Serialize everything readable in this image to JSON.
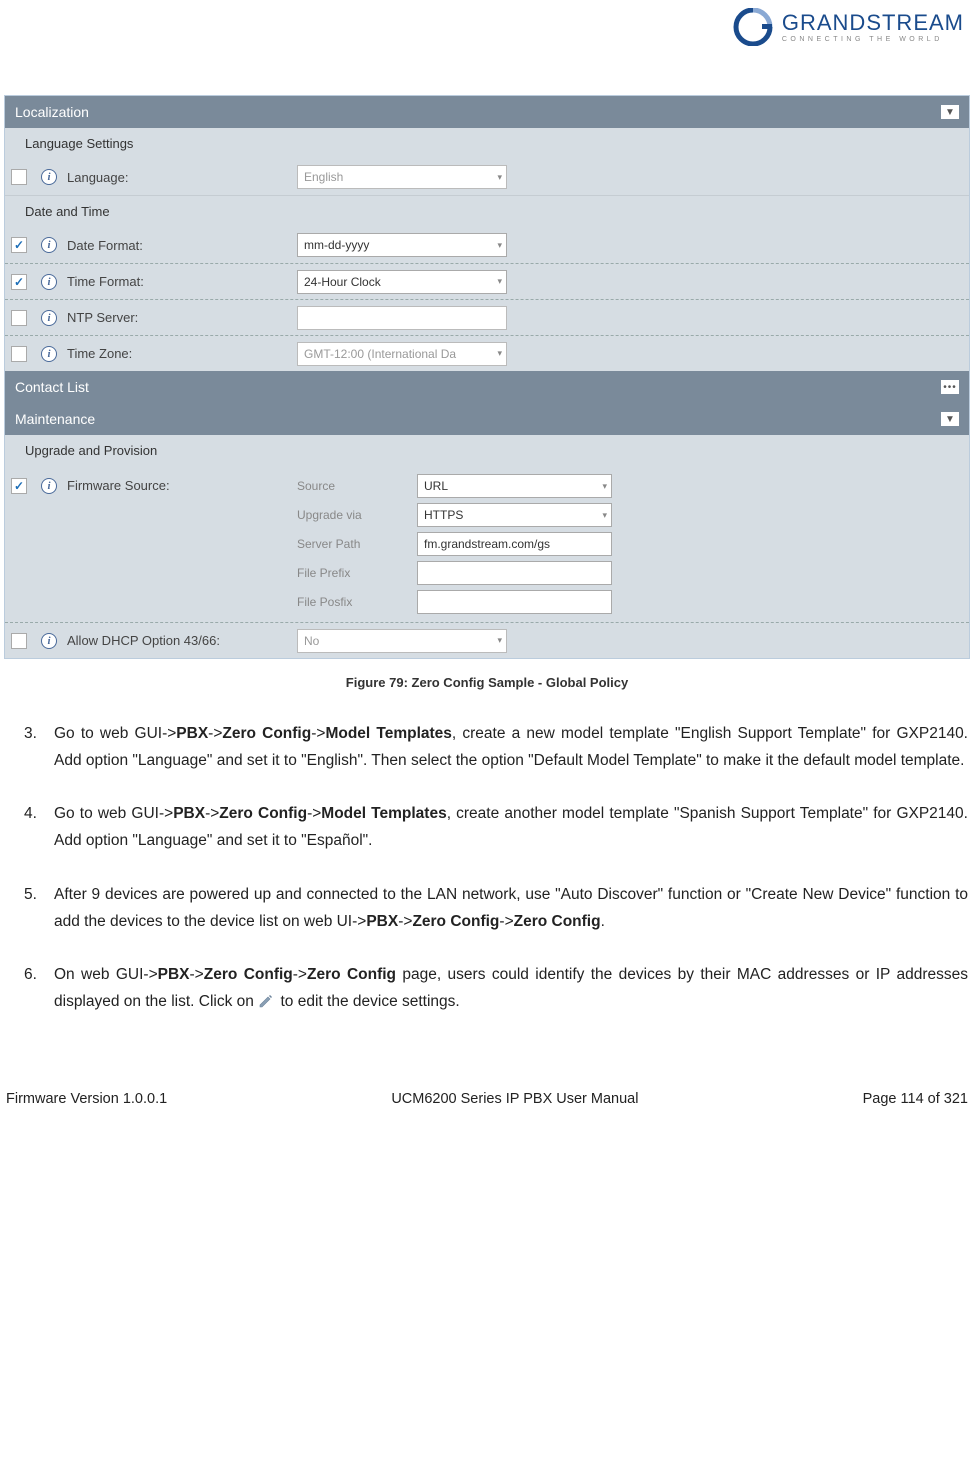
{
  "brand": {
    "name": "GRANDSTREAM",
    "tagline": "CONNECTING THE WORLD"
  },
  "panel": {
    "sec_localization": "Localization",
    "heading_lang": "Language Settings",
    "language_label": "Language:",
    "language_value": "English",
    "heading_dt": "Date and Time",
    "date_format_label": "Date Format:",
    "date_format_value": "mm-dd-yyyy",
    "time_format_label": "Time Format:",
    "time_format_value": "24-Hour Clock",
    "ntp_label": "NTP Server:",
    "ntp_value": "",
    "tz_label": "Time Zone:",
    "tz_value": "GMT-12:00 (International Da",
    "sec_contact": "Contact List",
    "sec_maint": "Maintenance",
    "heading_upgrade": "Upgrade and Provision",
    "fw_label": "Firmware Source:",
    "fw_source_label": "Source",
    "fw_source_value": "URL",
    "fw_via_label": "Upgrade via",
    "fw_via_value": "HTTPS",
    "fw_path_label": "Server Path",
    "fw_path_value": "fm.grandstream.com/gs",
    "fw_prefix_label": "File Prefix",
    "fw_prefix_value": "",
    "fw_postfix_label": "File Posfix",
    "fw_postfix_value": "",
    "dhcp_label": "Allow DHCP Option 43/66:",
    "dhcp_value": "No"
  },
  "caption": "Figure 79: Zero Config Sample - Global Policy",
  "steps": {
    "s3num": "3.",
    "s3a": "Go to web GUI->",
    "s3b": "PBX",
    "s3c": "->",
    "s3d": "Zero Config",
    "s3e": "->",
    "s3f": "Model Templates",
    "s3g": ", create a new model template \"English Support Template\" for GXP2140. Add option \"Language\" and set it to \"English\". Then select the option \"Default Model Template\" to make it the default model template.",
    "s4num": "4.",
    "s4a": "Go to web GUI->",
    "s4b": "PBX",
    "s4c": "->",
    "s4d": "Zero Config",
    "s4e": "->",
    "s4f": "Model Templates",
    "s4g": ", create another model template \"Spanish Support Template\" for GXP2140. Add option \"Language\" and set it to \"Español\".",
    "s5num": "5.",
    "s5a": "After 9 devices are powered up and connected to the LAN network, use \"Auto Discover\" function or \"Create New Device\" function to add the devices to the device list on web UI->",
    "s5b": "PBX",
    "s5c": "->",
    "s5d": "Zero Config",
    "s5e": "->",
    "s5f": "Zero Config",
    "s5g": ".",
    "s6num": "6.",
    "s6a": "On web GUI->",
    "s6b": "PBX",
    "s6c": "->",
    "s6d": "Zero Config",
    "s6e": "->",
    "s6f": "Zero Config",
    "s6g": " page, users could identify the devices by their MAC addresses or IP addresses displayed on the list. Click on ",
    "s6h": " to edit the device settings."
  },
  "footer": {
    "left": "Firmware Version 1.0.0.1",
    "center": "UCM6200 Series IP PBX User Manual",
    "right": "Page 114 of 321"
  }
}
